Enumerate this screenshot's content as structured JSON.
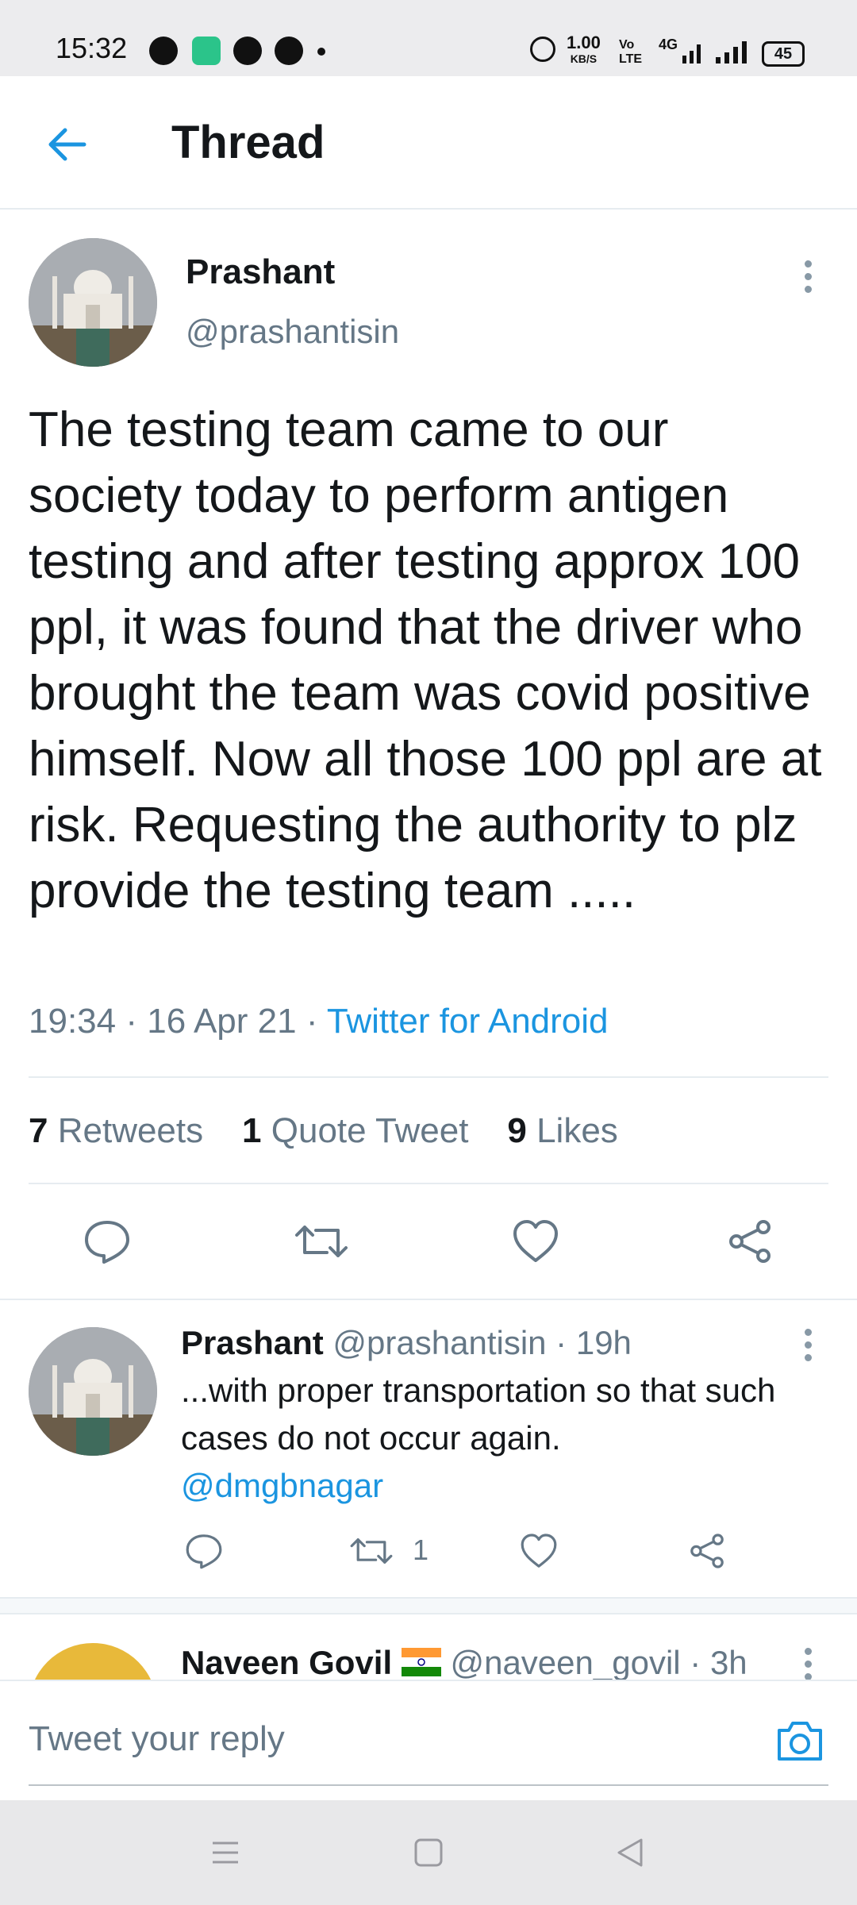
{
  "status": {
    "time": "15:32",
    "net_speed": "1.00",
    "net_unit": "KB/S",
    "volte": "Vo LTE",
    "network": "4G",
    "battery": "45"
  },
  "header": {
    "title": "Thread"
  },
  "main_tweet": {
    "name": "Prashant",
    "handle": "@prashantisin",
    "text": "The testing team came to our society today to perform antigen testing and after testing approx 100 ppl, it was found that the driver who brought the team was covid positive himself. Now all those 100 ppl are at risk. Requesting the authority to plz provide the testing team .....",
    "time": "19:34",
    "date": "16 Apr 21",
    "source": "Twitter for Android",
    "stats": {
      "retweets_count": "7",
      "retweets_label": "Retweets",
      "quotes_count": "1",
      "quotes_label": "Quote Tweet",
      "likes_count": "9",
      "likes_label": "Likes"
    }
  },
  "reply": {
    "name": "Prashant",
    "handle": "@prashantisin",
    "age": "19h",
    "text": "...with proper transportation so that such cases do not occur again.",
    "mention": "@dmgbnagar",
    "retweet_count": "1"
  },
  "next_reply": {
    "name": "Naveen Govil",
    "handle": "@naveen_govil",
    "age": "3h"
  },
  "compose": {
    "placeholder": "Tweet your reply"
  },
  "colors": {
    "accent": "#1b95e0",
    "text": "#14171a",
    "muted": "#657786"
  },
  "icons": [
    "back-arrow-icon",
    "more-icon",
    "reply-icon",
    "retweet-icon",
    "like-icon",
    "share-icon",
    "camera-icon",
    "india-flag-icon",
    "menu-nav-icon",
    "home-nav-icon",
    "back-nav-icon"
  ]
}
